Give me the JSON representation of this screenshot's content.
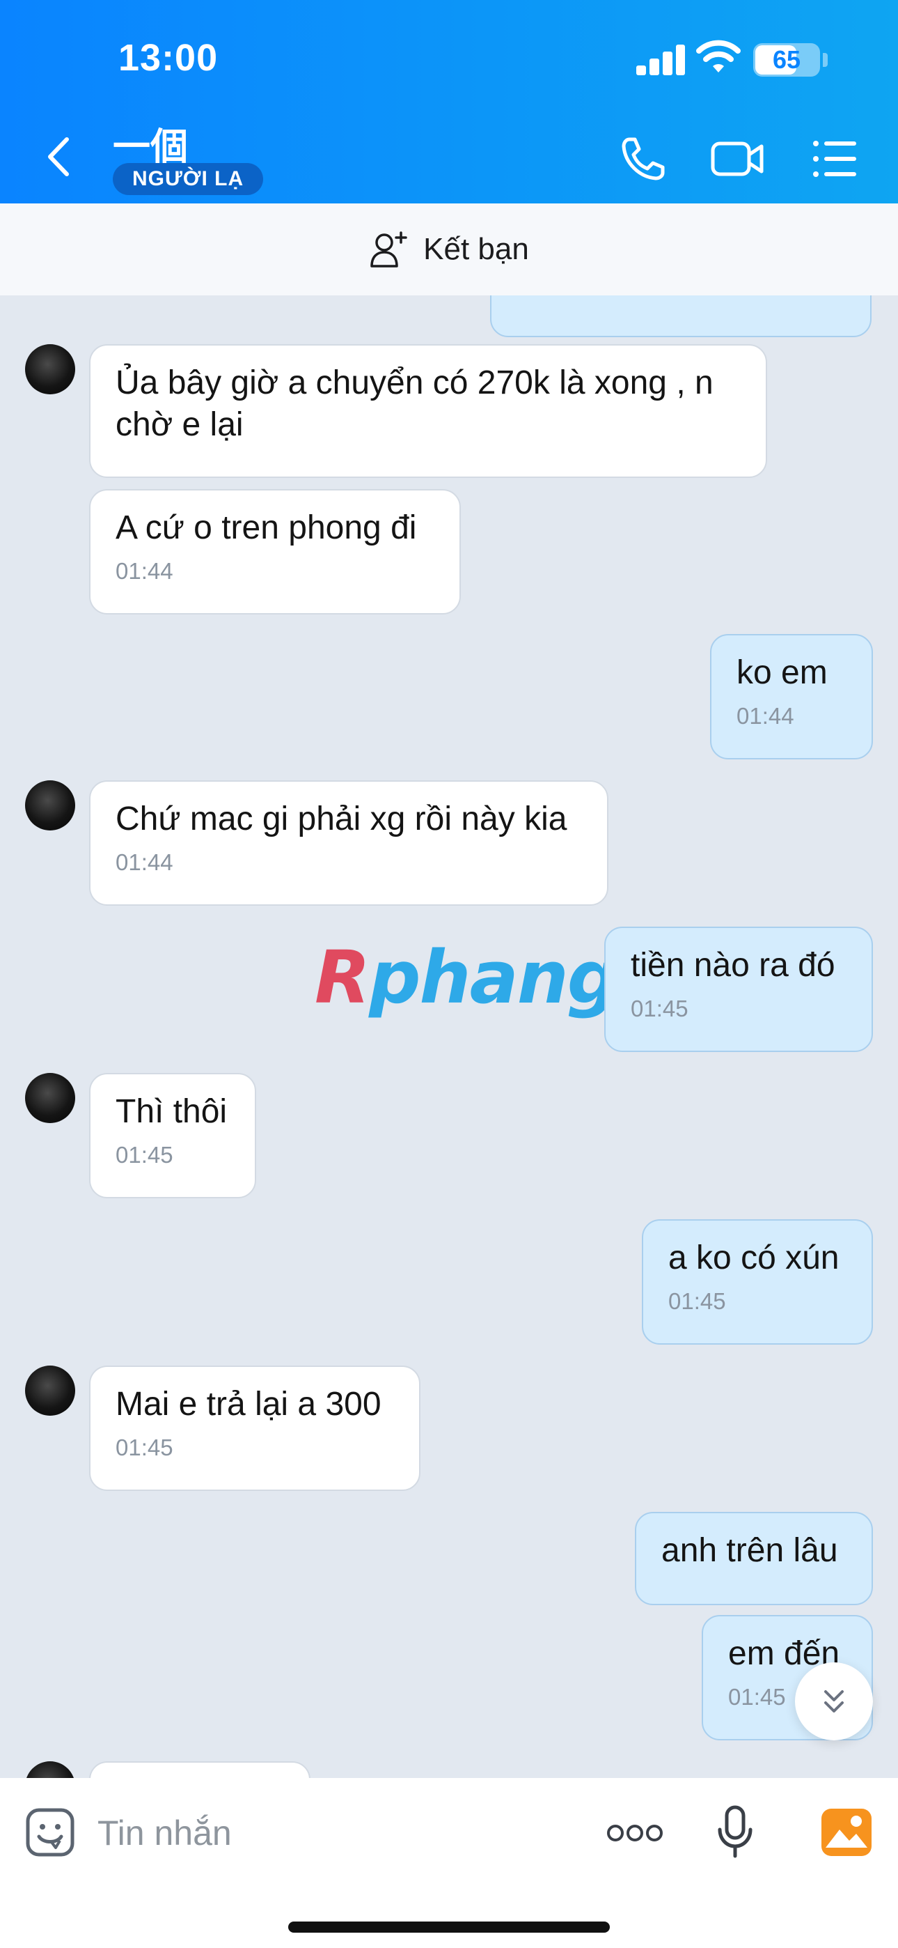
{
  "status_bar": {
    "time": "13:00",
    "battery": "65",
    "battery_level": 0.65
  },
  "header": {
    "contact_name": "一個",
    "badge": "NGƯỜI LẠ",
    "icons": [
      "back-arrow-icon",
      "phone-icon",
      "video-call-icon",
      "menu-list-icon"
    ]
  },
  "friend_bar": {
    "label": "Kết bạn",
    "icon": "add-friend-icon"
  },
  "messages": [
    {
      "side": "in",
      "text": "Ủa bây giờ a chuyển có 270k là xong , n chờ e lại",
      "time": ""
    },
    {
      "side": "in",
      "text": "A cứ o tren phong đi",
      "time": "01:44"
    },
    {
      "side": "out",
      "text": "ko em",
      "time": "01:44"
    },
    {
      "side": "in",
      "text": "Chứ mac gi phải xg rồi này kia",
      "time": "01:44"
    },
    {
      "side": "out",
      "text": "tiền nào ra đó",
      "time": "01:45"
    },
    {
      "side": "in",
      "text": "Thì thôi",
      "time": "01:45"
    },
    {
      "side": "out",
      "text": "a ko có xún",
      "time": "01:45"
    },
    {
      "side": "in",
      "text": "Mai e trả lại a 300",
      "time": "01:45"
    },
    {
      "side": "out",
      "text": "anh trên lâu",
      "time": ""
    },
    {
      "side": "out",
      "text": "em đến",
      "time": "01:45"
    }
  ],
  "watermark": {
    "part1": "R",
    "part2": "phang"
  },
  "input_bar": {
    "placeholder": "Tin nhắn",
    "icons": [
      "sticker-icon",
      "more-icon",
      "microphone-icon",
      "image-icon"
    ]
  }
}
